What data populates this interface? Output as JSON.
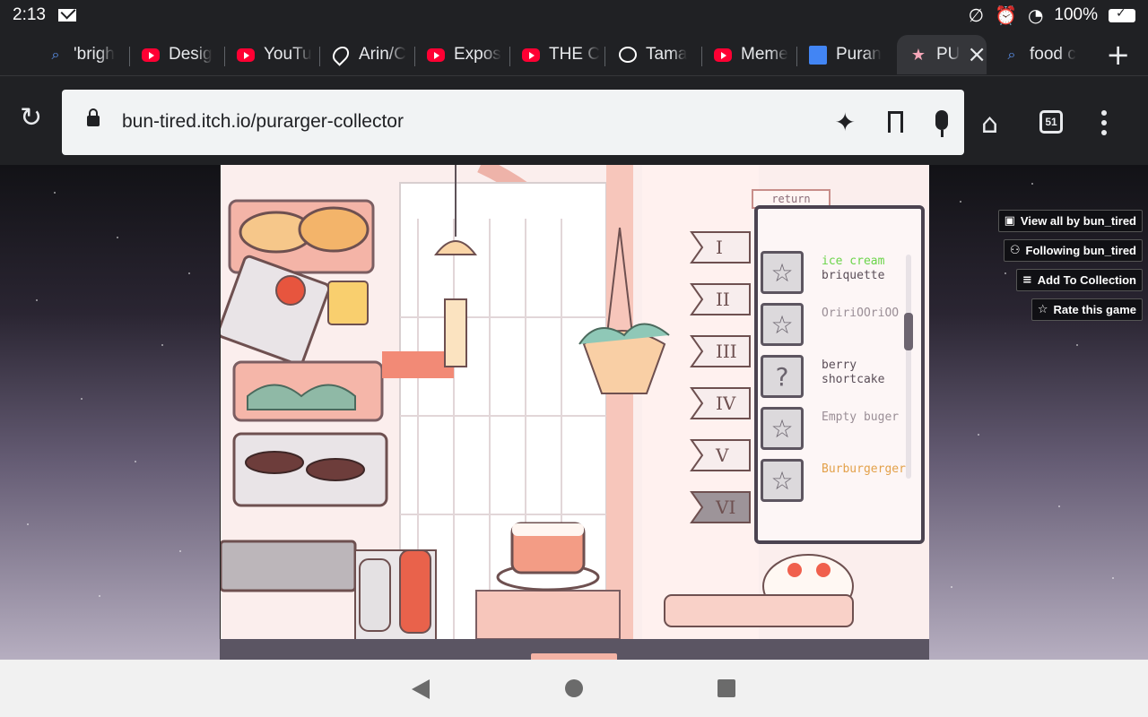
{
  "status_bar": {
    "time": "2:13",
    "battery": "100%",
    "icons": [
      "mail-icon",
      "no-sync-icon",
      "alarm-icon",
      "wifi-icon",
      "battery-icon"
    ]
  },
  "tabs": [
    {
      "label": "'brigh",
      "icon": "search-icon",
      "type": "search"
    },
    {
      "label": "Desig",
      "icon": "youtube-icon",
      "type": "yt"
    },
    {
      "label": "YouTu",
      "icon": "youtube-icon",
      "type": "yt"
    },
    {
      "label": "Arin/C",
      "icon": "maps-icon",
      "type": "maps"
    },
    {
      "label": "Expos",
      "icon": "youtube-icon",
      "type": "yt"
    },
    {
      "label": "THE C",
      "icon": "youtube-icon",
      "type": "yt"
    },
    {
      "label": "Tama",
      "icon": "openai-icon",
      "type": "gpt"
    },
    {
      "label": "Meme",
      "icon": "youtube-icon",
      "type": "yt"
    },
    {
      "label": "Puran",
      "icon": "docs-icon",
      "type": "docs"
    },
    {
      "label": "PU",
      "icon": "star-icon",
      "type": "star",
      "active": true
    },
    {
      "label": "food c",
      "icon": "search-icon",
      "type": "search"
    }
  ],
  "toolbar": {
    "url": "bun-tired.itch.io/purarger-collector",
    "tab_count": "51"
  },
  "itch": {
    "view_all": "View all by bun_tired",
    "following": "Following bun_tired",
    "add_collection": "Add To Collection",
    "rate": "Rate this game"
  },
  "game": {
    "return_label": "return",
    "numerals": [
      "I",
      "II",
      "III",
      "IV",
      "V",
      "VI"
    ],
    "collection": [
      {
        "highlight": "ice cream",
        "name": "briquette",
        "style": "normal",
        "slot": "star"
      },
      {
        "name": "OririOOriOO",
        "style": "faded",
        "slot": "star"
      },
      {
        "name": "berry shortcake",
        "style": "normal",
        "slot": "question"
      },
      {
        "name": "Empty buger",
        "style": "faded",
        "slot": "star"
      },
      {
        "name": "Burburgerger",
        "style": "gold",
        "slot": "star"
      }
    ]
  }
}
